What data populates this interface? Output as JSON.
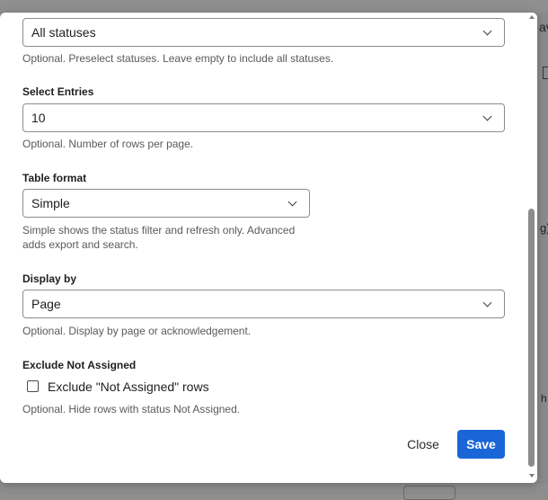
{
  "background": {
    "right_fragment_top": "av",
    "right_fragment_mid": "g)",
    "right_fragment_low": "h"
  },
  "statuses": {
    "selected": "All statuses",
    "help": "Optional. Preselect statuses. Leave empty to include all statuses."
  },
  "entries": {
    "label": "Select Entries",
    "selected": "10",
    "help": "Optional. Number of rows per page."
  },
  "table_format": {
    "label": "Table format",
    "selected": "Simple",
    "help": "Simple shows the status filter and refresh only. Advanced adds export and search."
  },
  "display_by": {
    "label": "Display by",
    "selected": "Page",
    "help": "Optional. Display by page or acknowledgement."
  },
  "exclude": {
    "label": "Exclude Not Assigned",
    "checkbox_label": "Exclude \"Not Assigned\" rows",
    "checked": false,
    "help": "Optional. Hide rows with status Not Assigned."
  },
  "actions": {
    "close_label": "Close",
    "save_label": "Save"
  },
  "colors": {
    "primary": "#1a66d8",
    "overlay": "#8f8f8f"
  }
}
